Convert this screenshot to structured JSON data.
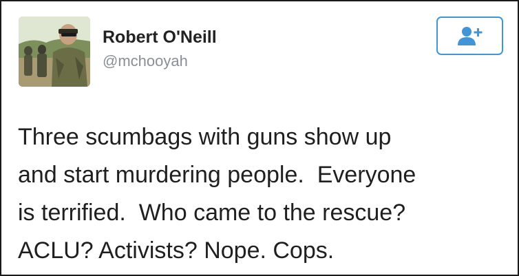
{
  "tweet": {
    "author": {
      "display_name": "Robert O'Neill",
      "handle": "@mchooyah",
      "avatar_icon": "profile-photo"
    },
    "follow_button": {
      "icon": "add-user-icon",
      "color": "#3f95d8"
    },
    "text_lines": [
      "Three scumbags with guns show up",
      "and start murdering people.  Everyone",
      "is terrified.  Who came to the rescue?",
      "ACLU? Activists? Nope. Cops."
    ]
  }
}
